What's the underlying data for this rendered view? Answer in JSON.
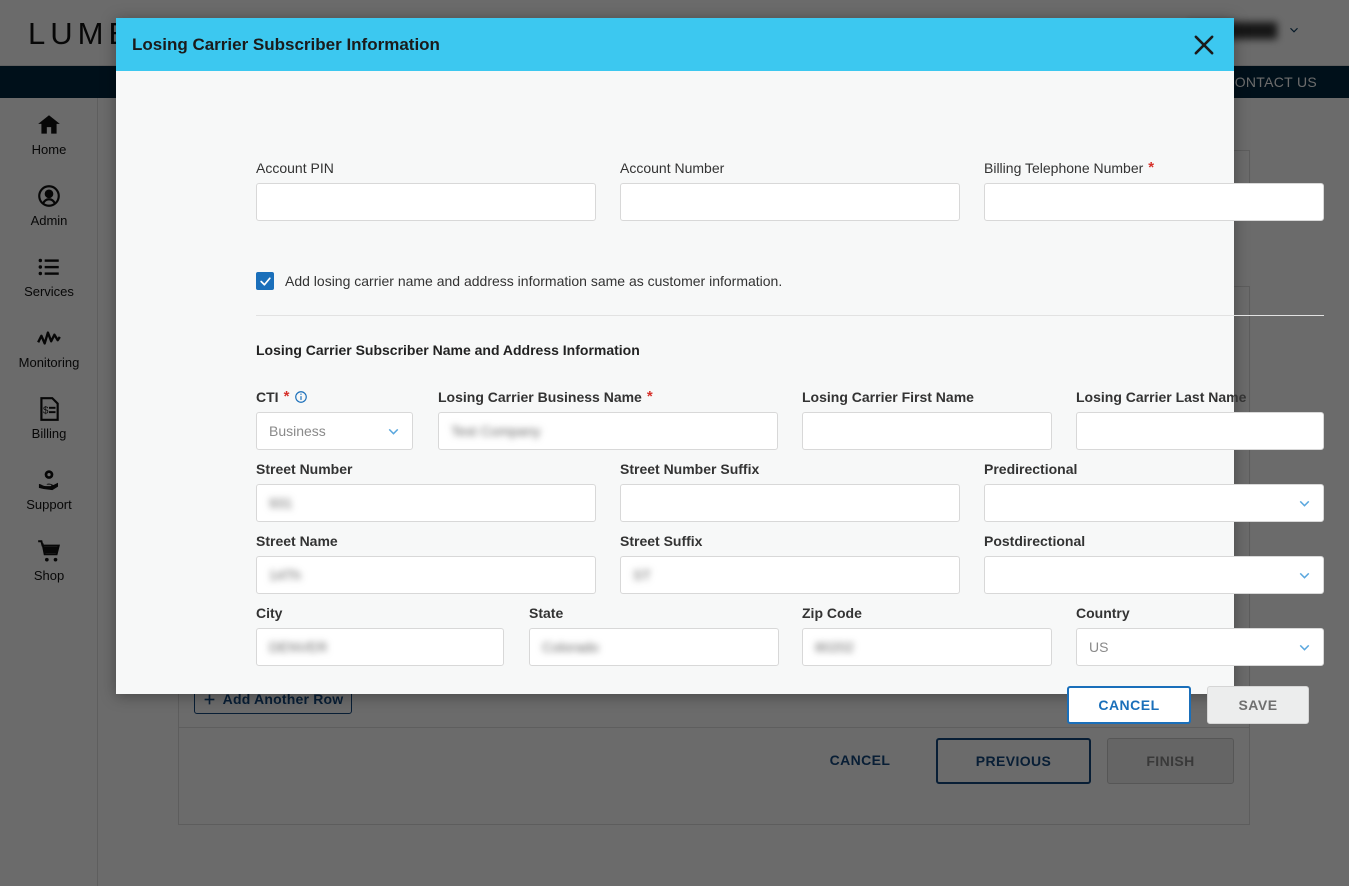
{
  "app": {
    "logo_text": "LUMEN",
    "user_name_masked": "█████████",
    "nav_contact": "CONTACT US"
  },
  "sidebar": {
    "items": [
      {
        "label": "Home",
        "icon": "home-icon"
      },
      {
        "label": "Admin",
        "icon": "user-circle-icon"
      },
      {
        "label": "Services",
        "icon": "list-icon"
      },
      {
        "label": "Monitoring",
        "icon": "activity-icon"
      },
      {
        "label": "Billing",
        "icon": "invoice-icon"
      },
      {
        "label": "Support",
        "icon": "support-gear-hand-icon"
      },
      {
        "label": "Shop",
        "icon": "cart-icon"
      }
    ]
  },
  "background_page": {
    "add_another_row": "Add Another Row",
    "cancel": "CANCEL",
    "previous": "PREVIOUS",
    "finish": "FINISH"
  },
  "modal": {
    "title": "Losing Carrier Subscriber Information",
    "close_icon": "close-icon",
    "account_pin": {
      "label": "Account PIN",
      "value": "",
      "required": false
    },
    "account_number": {
      "label": "Account Number",
      "value": "",
      "required": false
    },
    "billing_telephone_number": {
      "label": "Billing Telephone Number",
      "value": "",
      "required": true,
      "required_mark": "*"
    },
    "same_as_customer": {
      "label": "Add losing carrier name and address information same as customer information.",
      "checked": true
    },
    "section_title": "Losing Carrier Subscriber Name and Address Information",
    "fields": {
      "cti": {
        "label": "CTI",
        "required_mark": "*",
        "value": "Business",
        "type": "select",
        "info_icon": "info-icon"
      },
      "business_name": {
        "label": "Losing Carrier Business Name",
        "required_mark": "*",
        "value": "Test Company",
        "masked": true
      },
      "first_name": {
        "label": "Losing Carrier First Name",
        "value": ""
      },
      "last_name": {
        "label": "Losing Carrier Last Name",
        "value": ""
      },
      "street_number": {
        "label": "Street Number",
        "value": "931",
        "masked": true
      },
      "street_number_suffix": {
        "label": "Street Number Suffix",
        "value": ""
      },
      "predirectional": {
        "label": "Predirectional",
        "value": "",
        "type": "select"
      },
      "street_name": {
        "label": "Street Name",
        "value": "14Th",
        "masked": true
      },
      "street_suffix": {
        "label": "Street Suffix",
        "value": "ST",
        "masked": true
      },
      "postdirectional": {
        "label": "Postdirectional",
        "value": "",
        "type": "select"
      },
      "city": {
        "label": "City",
        "value": "DENVER",
        "masked": true
      },
      "state": {
        "label": "State",
        "value": "Colorado",
        "masked": true
      },
      "zip_code": {
        "label": "Zip Code",
        "value": "80202",
        "masked": true
      },
      "country": {
        "label": "Country",
        "value": "US",
        "type": "select"
      }
    },
    "cancel_button": "CANCEL",
    "save_button": "SAVE"
  },
  "colors": {
    "modal_header": "#3cc8f0",
    "accent_blue": "#1a6fba",
    "nav_navy": "#00263e",
    "required_red": "#d6312b"
  }
}
